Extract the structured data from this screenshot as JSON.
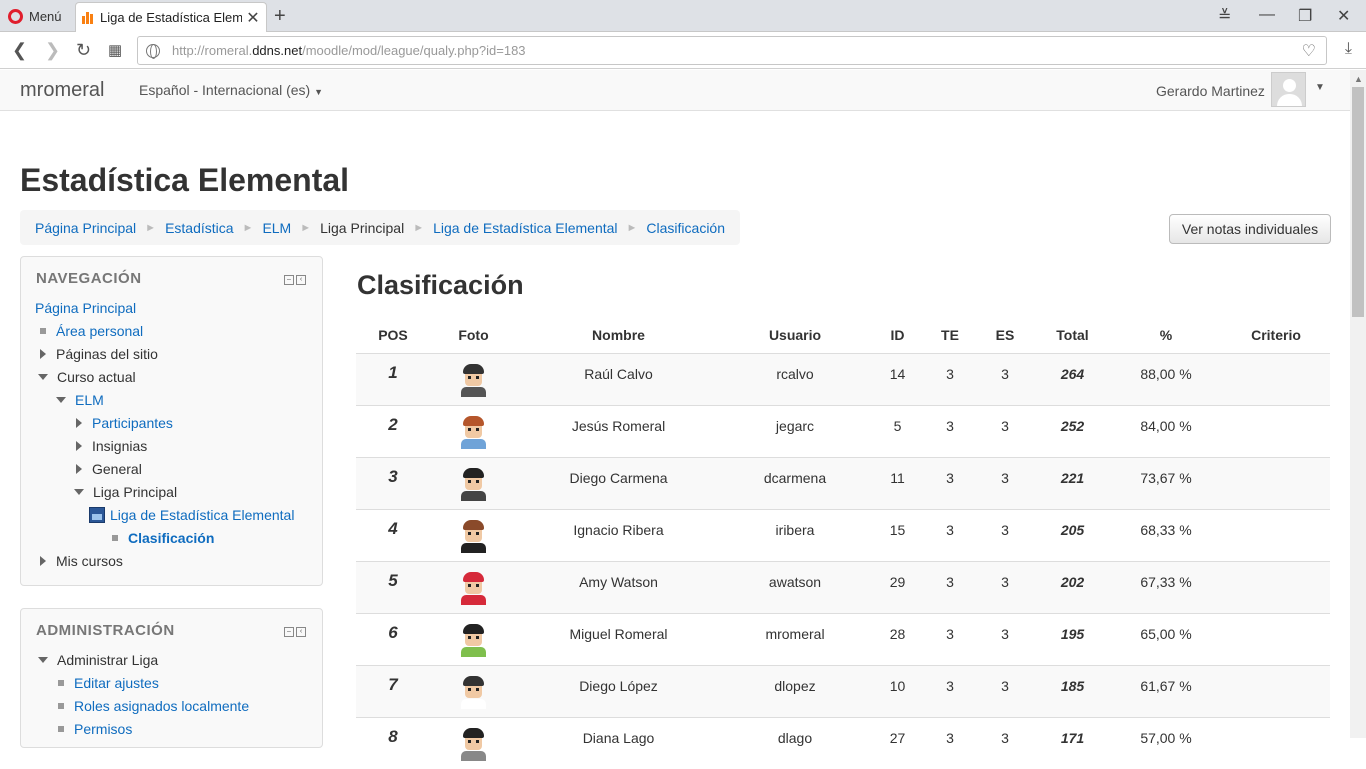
{
  "browser": {
    "menu_label": "Menú",
    "tab_title": "Liga de Estadística Elemental",
    "url_prefix": "http://romeral.",
    "url_host": "ddns.net",
    "url_path": "/moodle/mod/league/qualy.php?id=183"
  },
  "navbar": {
    "brand": "mromeral",
    "language": "Español - Internacional (es)",
    "user_name": "Gerardo Martinez"
  },
  "page": {
    "title": "Estadística Elemental",
    "breadcrumb": [
      "Página Principal",
      "Estadística",
      "ELM",
      "Liga Principal",
      "Liga de Estadística Elemental",
      "Clasificación"
    ],
    "notas_button": "Ver notas individuales"
  },
  "nav_block": {
    "title": "NAVEGACIÓN",
    "items": [
      {
        "label": "Página Principal"
      },
      {
        "label": "Área personal"
      },
      {
        "label": "Páginas del sitio"
      },
      {
        "label": "Curso actual"
      },
      {
        "label": "ELM"
      },
      {
        "label": "Participantes"
      },
      {
        "label": "Insignias"
      },
      {
        "label": "General"
      },
      {
        "label": "Liga Principal"
      },
      {
        "label": "Liga de Estadística Elemental"
      },
      {
        "label": "Clasificación"
      },
      {
        "label": "Mis cursos"
      }
    ]
  },
  "admin_block": {
    "title": "ADMINISTRACIÓN",
    "items": [
      {
        "label": "Administrar Liga"
      },
      {
        "label": "Editar ajustes"
      },
      {
        "label": "Roles asignados localmente"
      },
      {
        "label": "Permisos"
      }
    ]
  },
  "ranking": {
    "title": "Clasificación",
    "columns": [
      "POS",
      "Foto",
      "Nombre",
      "Usuario",
      "ID",
      "TE",
      "ES",
      "Total",
      "%",
      "Criterio"
    ],
    "rows": [
      {
        "pos": "1",
        "nombre": "Raúl Calvo",
        "usuario": "rcalvo",
        "id": "14",
        "te": "3",
        "es": "3",
        "total": "264",
        "pct": "88,00 %",
        "criterio": ""
      },
      {
        "pos": "2",
        "nombre": "Jesús Romeral",
        "usuario": "jegarc",
        "id": "5",
        "te": "3",
        "es": "3",
        "total": "252",
        "pct": "84,00 %",
        "criterio": ""
      },
      {
        "pos": "3",
        "nombre": "Diego Carmena",
        "usuario": "dcarmena",
        "id": "11",
        "te": "3",
        "es": "3",
        "total": "221",
        "pct": "73,67 %",
        "criterio": ""
      },
      {
        "pos": "4",
        "nombre": "Ignacio Ribera",
        "usuario": "iribera",
        "id": "15",
        "te": "3",
        "es": "3",
        "total": "205",
        "pct": "68,33 %",
        "criterio": ""
      },
      {
        "pos": "5",
        "nombre": "Amy Watson",
        "usuario": "awatson",
        "id": "29",
        "te": "3",
        "es": "3",
        "total": "202",
        "pct": "67,33 %",
        "criterio": ""
      },
      {
        "pos": "6",
        "nombre": "Miguel Romeral",
        "usuario": "mromeral",
        "id": "28",
        "te": "3",
        "es": "3",
        "total": "195",
        "pct": "65,00 %",
        "criterio": ""
      },
      {
        "pos": "7",
        "nombre": "Diego López",
        "usuario": "dlopez",
        "id": "10",
        "te": "3",
        "es": "3",
        "total": "185",
        "pct": "61,67 %",
        "criterio": ""
      },
      {
        "pos": "8",
        "nombre": "Diana Lago",
        "usuario": "dlago",
        "id": "27",
        "te": "3",
        "es": "3",
        "total": "171",
        "pct": "57,00 %",
        "criterio": ""
      }
    ]
  },
  "avatar_styles": [
    {
      "hair": "#333333",
      "shirt": "#555555"
    },
    {
      "hair": "#b5562b",
      "shirt": "#6fa3d8"
    },
    {
      "hair": "#222222",
      "shirt": "#444444"
    },
    {
      "hair": "#8a4a2a",
      "shirt": "#222222"
    },
    {
      "hair": "#d62a3a",
      "shirt": "#d62a3a"
    },
    {
      "hair": "#222222",
      "shirt": "#7fbf4d"
    },
    {
      "hair": "#333333",
      "shirt": "#ffffff"
    },
    {
      "hair": "#222222",
      "shirt": "#888888"
    }
  ]
}
